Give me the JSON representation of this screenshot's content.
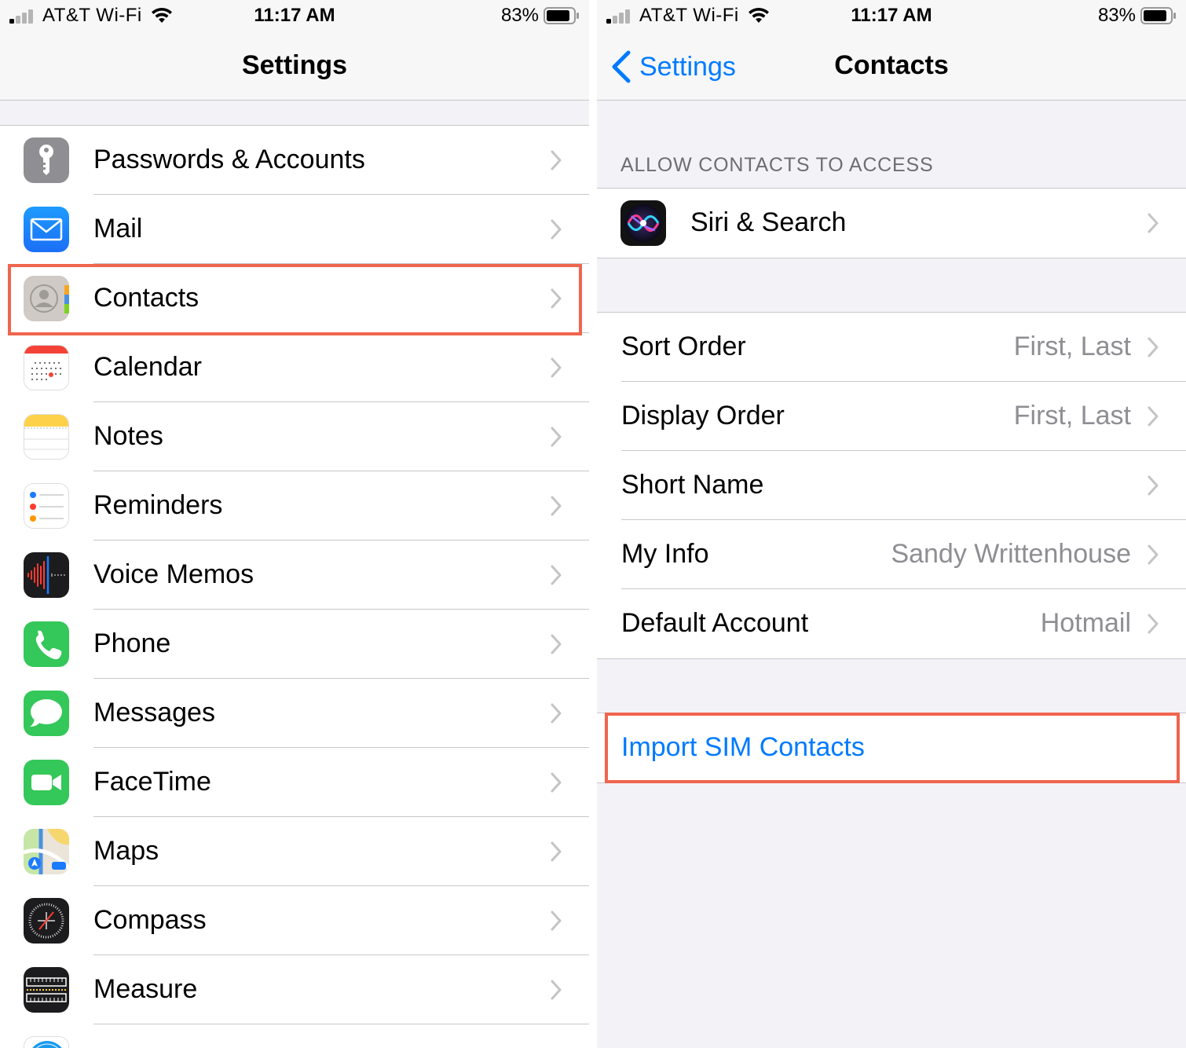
{
  "status_bar": {
    "carrier": "AT&T Wi-Fi",
    "time": "11:17 AM",
    "battery": "83%"
  },
  "settings_screen": {
    "title": "Settings",
    "items": [
      {
        "label": "Passwords & Accounts",
        "icon": "key-icon"
      },
      {
        "label": "Mail",
        "icon": "mail-icon"
      },
      {
        "label": "Contacts",
        "icon": "contacts-icon",
        "highlighted": true
      },
      {
        "label": "Calendar",
        "icon": "calendar-icon"
      },
      {
        "label": "Notes",
        "icon": "notes-icon"
      },
      {
        "label": "Reminders",
        "icon": "reminders-icon"
      },
      {
        "label": "Voice Memos",
        "icon": "voice-memos-icon"
      },
      {
        "label": "Phone",
        "icon": "phone-icon"
      },
      {
        "label": "Messages",
        "icon": "messages-icon"
      },
      {
        "label": "FaceTime",
        "icon": "facetime-icon"
      },
      {
        "label": "Maps",
        "icon": "maps-icon"
      },
      {
        "label": "Compass",
        "icon": "compass-icon"
      },
      {
        "label": "Measure",
        "icon": "measure-icon"
      }
    ]
  },
  "contacts_screen": {
    "back_label": "Settings",
    "title": "Contacts",
    "section_header": "ALLOW CONTACTS TO ACCESS",
    "siri_item": {
      "label": "Siri & Search",
      "icon": "siri-icon"
    },
    "options": [
      {
        "label": "Sort Order",
        "value": "First, Last"
      },
      {
        "label": "Display Order",
        "value": "First, Last"
      },
      {
        "label": "Short Name",
        "value": ""
      },
      {
        "label": "My Info",
        "value": "Sandy Writtenhouse"
      },
      {
        "label": "Default Account",
        "value": "Hotmail"
      }
    ],
    "import_action": {
      "label": "Import SIM Contacts",
      "highlighted": true
    }
  },
  "colors": {
    "accent": "#007aff",
    "highlight": "#f0654e",
    "secondary_text": "#8e8e93",
    "group_background": "#f2f2f7"
  }
}
